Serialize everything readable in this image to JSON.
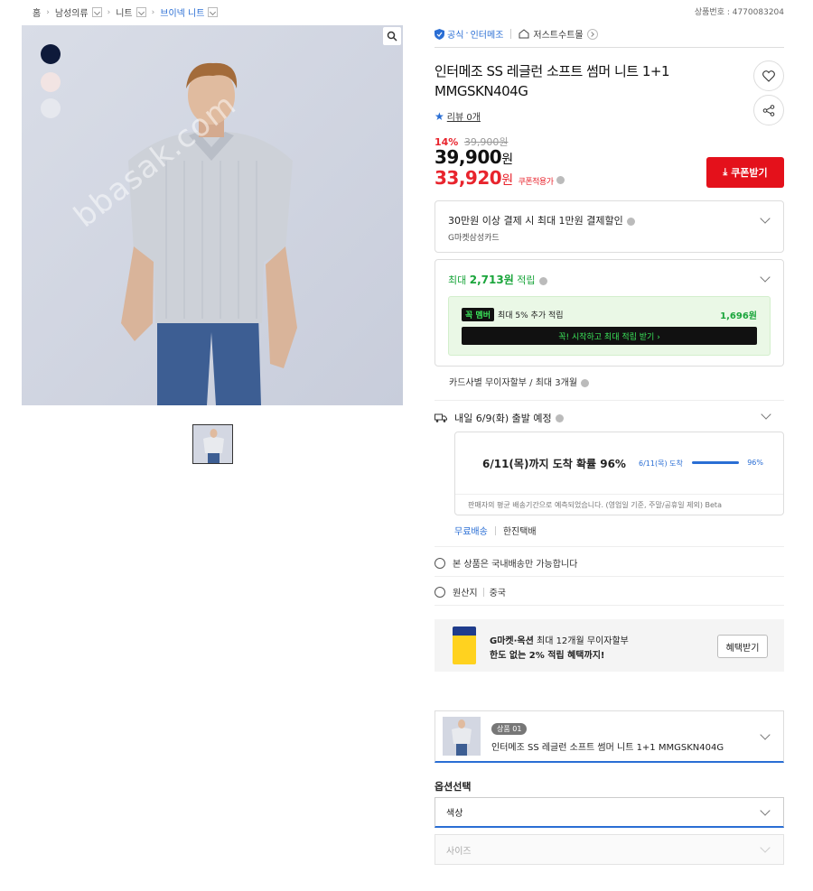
{
  "breadcrumb": {
    "home": "홈",
    "level1": "남성의류",
    "level2": "니트",
    "level3": "브이넥 니트"
  },
  "product_number": "상품번호 : 4770083204",
  "store": {
    "official_badge": "공식",
    "brand": "인터메조",
    "shop_name": "저스트수트몰"
  },
  "product": {
    "title": "인터메조 SS 레글런 소프트 썸머 니트 1+1 MMGSKN404G",
    "review_label": "리뷰 0개",
    "discount_pct": "14%",
    "original_price": "39,900원",
    "price_value": "39,900",
    "price_unit": "원",
    "coupon_price_value": "33,920",
    "coupon_price_unit": "원",
    "coupon_applied_label": "쿠폰적용가",
    "coupon_button": "쿠폰받기"
  },
  "color_swatches": [
    "#0e1a3a",
    "#f2e4e3",
    "#e6e8ee"
  ],
  "watermark": "bbasak.com",
  "card_discount": {
    "title": "30만원 이상 결제 시 최대 1만원 결제할인",
    "card": "G마켓삼성카드"
  },
  "points": {
    "title_prefix": "최대 ",
    "title_amount": "2,713원",
    "title_suffix": " 적립",
    "member_badge": "멤버",
    "member_text": "최대 5% 추가 적립",
    "member_amount": "1,696원",
    "cta": "꼭! 시작하고 최대 적립 받기 ›"
  },
  "installment": "카드사별 무이자할부 / 최대 3개월",
  "shipping": {
    "depart": "내일 6/9(화) 출발 예정",
    "arrival": "6/11(목)까지 도착 확률 96%",
    "arrival_small": "6/11(목) 도착",
    "arrival_pct": "96%",
    "arrival_pct_value": 96,
    "note": "판매자의 평균 배송기간으로 예측되었습니다. (영업일 기준, 주말/공휴일 제외) Beta",
    "free": "무료배송",
    "courier": "한진택배"
  },
  "domestic_only": "본 상품은 국내배송만 가능합니다",
  "origin": {
    "label": "원산지",
    "value": "중국"
  },
  "promo": {
    "line1_bold": "G마켓·옥션",
    "line1_rest": " 최대 12개월 무이자할부",
    "line2": "한도 없는 2% 적립 혜택까지!",
    "button": "혜택받기"
  },
  "option_product": {
    "badge": "상품 01",
    "name": "인터메조 SS 레글런 소프트 썸머 니트 1+1 MMGSKN404G"
  },
  "option_select": {
    "label": "옵션선택",
    "color": "색상",
    "size": "사이즈"
  },
  "colors": {
    "accent": "#2a6ed4",
    "red": "#e4111b",
    "green": "#1aa53b"
  }
}
